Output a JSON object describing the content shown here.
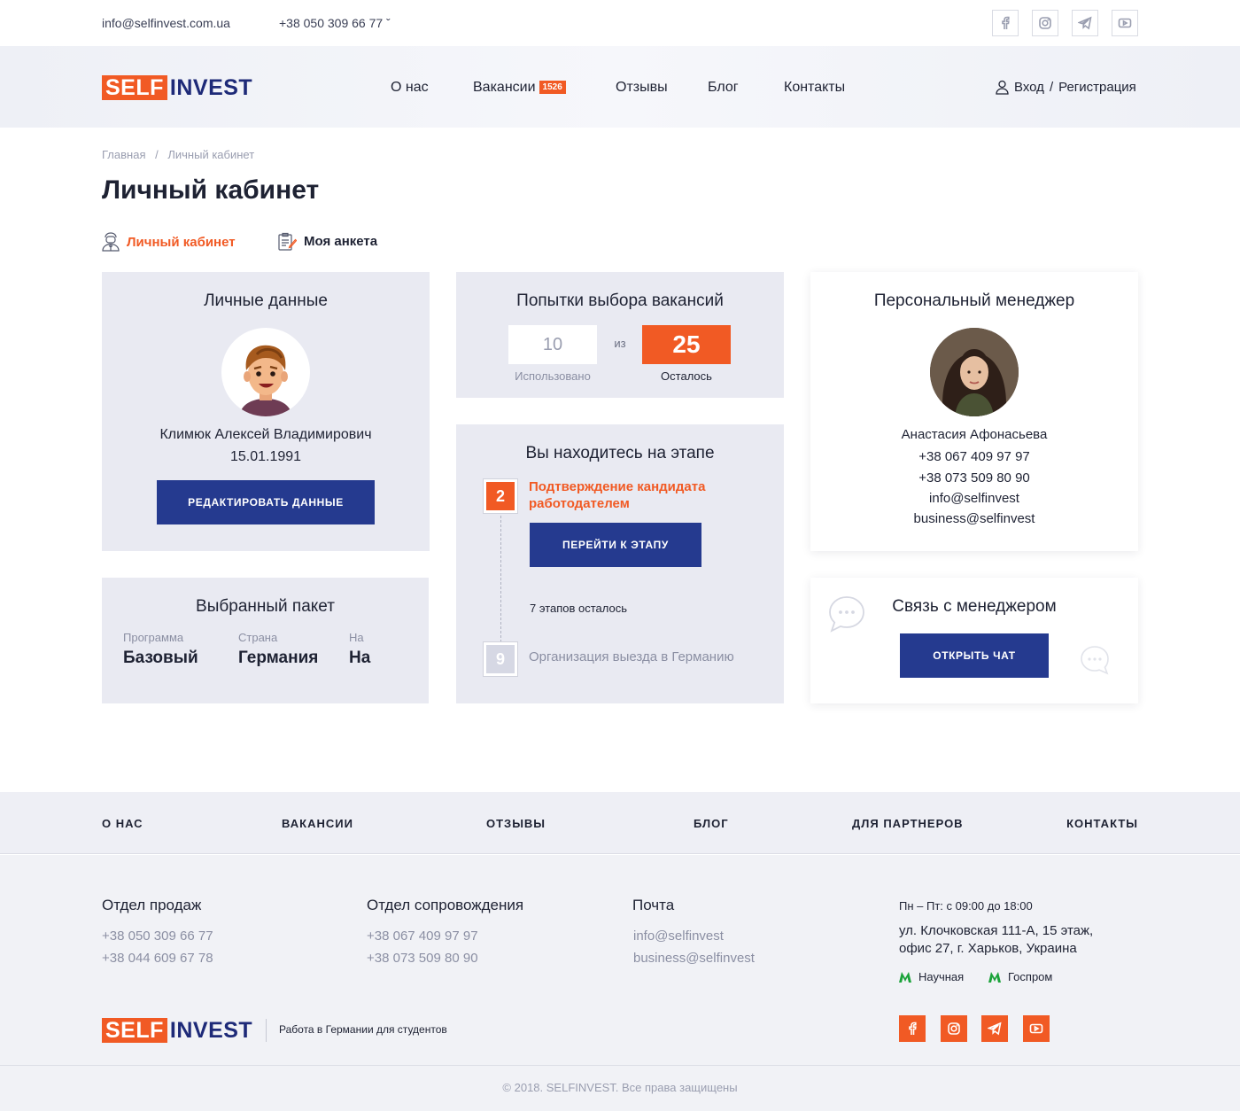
{
  "topbar": {
    "email": "info@selfinvest.com.ua",
    "phone": "+38 050 309 66 77 ˇ"
  },
  "logo": {
    "part1": "SELF",
    "part2": "INVEST"
  },
  "nav": {
    "about": "О нас",
    "vacancies": "Вакансии",
    "vacancies_badge": "1526",
    "reviews": "Отзывы",
    "blog": "Блог",
    "contacts": "Контакты",
    "login": "Вход",
    "sep": "/",
    "register": "Регистрация"
  },
  "breadcrumb": {
    "home": "Главная",
    "sep": "/",
    "current": "Личный кабинет"
  },
  "page_title": "Личный кабинет",
  "tabs": {
    "cabinet": "Личный кабинет",
    "profile": "Моя анкета"
  },
  "personal": {
    "title": "Личные данные",
    "name": "Климюк Алексей Владимирович",
    "birth": "15.01.1991",
    "edit_button": "Редактировать данные"
  },
  "package": {
    "title": "Выбранный пакет",
    "program_label": "Программа",
    "program_value": "Базовый",
    "country_label": "Страна",
    "country_value": "Германия",
    "third_label": "На",
    "third_value": "На"
  },
  "attempts": {
    "title": "Попытки выбора вакансий",
    "used": "10",
    "used_label": "Использовано",
    "of": "из",
    "left": "25",
    "left_label": "Осталось"
  },
  "stage": {
    "title": "Вы находитесь на этапе",
    "current_num": "2",
    "current_title": "Подтверждение кандидата работодателем",
    "go_button": "Перейти к этапу",
    "remaining": "7 этапов осталось",
    "final_num": "9",
    "final_title": "Организация выезда в Германию"
  },
  "manager": {
    "title": "Персональный менеджер",
    "name": "Анастасия Афонасьева",
    "phone1": "+38 067 409 97 97",
    "phone2": "+38 073 509 80 90",
    "email1": "info@selfinvest",
    "email2": "business@selfinvest"
  },
  "chat": {
    "title": "Связь с менеджером",
    "button": "Открыть чат"
  },
  "footer_nav": {
    "about": "О НАС",
    "vacancies": "ВАКАНСИИ",
    "reviews": "ОТЗЫВЫ",
    "blog": "БЛОГ",
    "partners": "ДЛЯ ПАРТНЕРОВ",
    "contacts": "КОНТАКТЫ"
  },
  "footer": {
    "sales_title": "Отдел продаж",
    "sales_phone1": "+38 050 309 66 77",
    "sales_phone2": "+38 044 609 67 78",
    "support_title": "Отдел сопровождения",
    "support_phone1": "+38 067 409 97 97",
    "support_phone2": "+38 073 509 80 90",
    "mail_title": "Почта",
    "mail1": "info@selfinvest",
    "mail2": "business@selfinvest",
    "hours": "Пн – Пт: с 09:00 до 18:00",
    "address1": "ул. Клочковская 111-А, 15 этаж,",
    "address2": "офис 27, г. Харьков, Украина",
    "metro1": "Научная",
    "metro2": "Госпром",
    "tagline": "Работа в Германии для студентов",
    "copyright": "© 2018. SELFINVEST. Все права защищены"
  },
  "colors": {
    "accent": "#f15a24",
    "primary": "#253a8f",
    "card_bg": "#e9eaf2"
  }
}
